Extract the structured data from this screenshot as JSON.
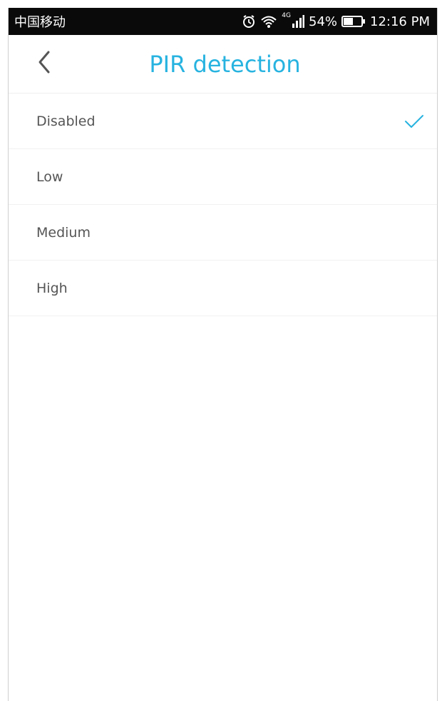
{
  "status_bar": {
    "carrier": "中国移动",
    "network_label": "4G",
    "battery_percent": "54%",
    "time": "12:16 PM",
    "icons": [
      "alarm-icon",
      "wifi-icon",
      "signal-icon",
      "battery-icon"
    ]
  },
  "header": {
    "title": "PIR detection",
    "back_icon": "chevron-left-icon"
  },
  "options": [
    {
      "label": "Disabled",
      "selected": true
    },
    {
      "label": "Low",
      "selected": false
    },
    {
      "label": "Medium",
      "selected": false
    },
    {
      "label": "High",
      "selected": false
    }
  ],
  "colors": {
    "accent": "#27b3e0",
    "status_bar_bg": "#0a0a0a",
    "label_text": "#555555"
  }
}
